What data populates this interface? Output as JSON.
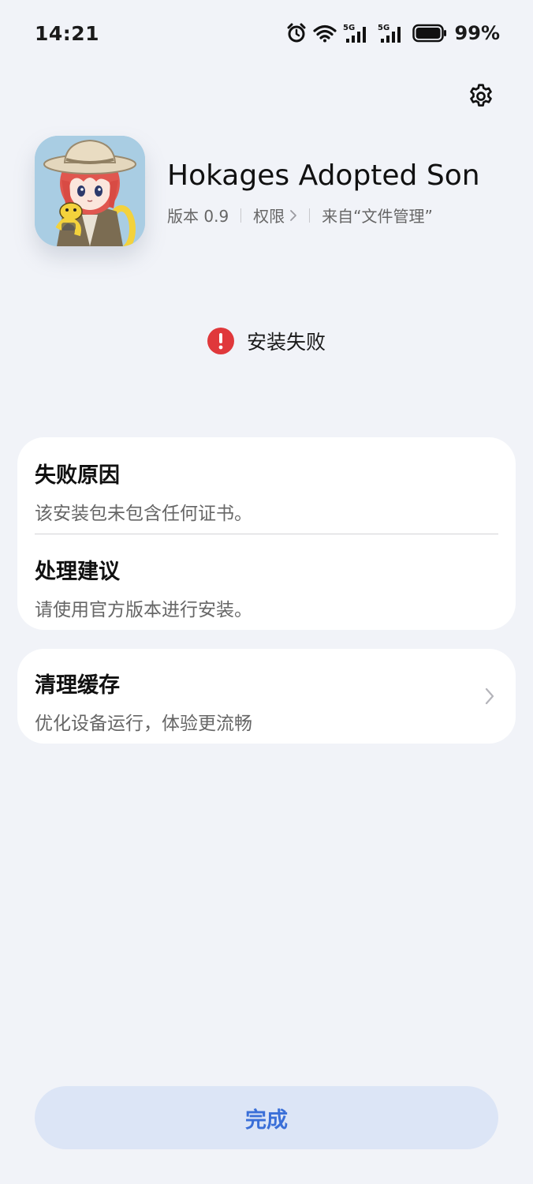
{
  "status_bar": {
    "time": "14:21",
    "battery_percent": "99%",
    "icons": [
      "alarm-icon",
      "wifi-icon",
      "signal-5g-icon",
      "signal-5g-icon",
      "battery-icon"
    ],
    "network_label": "5G"
  },
  "header": {
    "settings_icon": "gear-icon"
  },
  "app": {
    "name": "Hokages Adopted Son",
    "version": "版本 0.9",
    "permissions": "权限",
    "source": "来自“文件管理”",
    "icon": "app-icon-anime-character"
  },
  "install": {
    "status": "安装失败",
    "status_icon": "error-icon",
    "status_color": "#e0383b"
  },
  "failure": {
    "reason_title": "失败原因",
    "reason_text": "该安装包未包含任何证书。",
    "suggestion_title": "处理建议",
    "suggestion_text": "请使用官方版本进行安装。"
  },
  "cache": {
    "title": "清理缓存",
    "subtitle": "优化设备运行，体验更流畅"
  },
  "actions": {
    "done_label": "完成",
    "accent_color": "#3a6fd8"
  }
}
